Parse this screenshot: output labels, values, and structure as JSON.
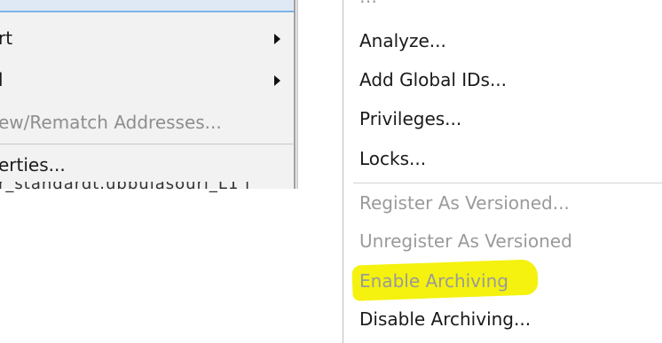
{
  "left_menu": {
    "items": [
      {
        "label": "rt",
        "submenu": true,
        "disabled": false
      },
      {
        "label": "l",
        "submenu": true,
        "disabled": false
      },
      {
        "label": "ew/Rematch Addresses...",
        "submenu": false,
        "disabled": true
      },
      {
        "label": "erties...",
        "submenu": false,
        "disabled": false
      }
    ]
  },
  "background_text": "r_standardt.ubbuiasouri_L1 i",
  "right_menu": {
    "items": [
      {
        "label": "Analyze...",
        "disabled": false
      },
      {
        "label": "Add Global IDs...",
        "disabled": false
      },
      {
        "label": "Privileges...",
        "disabled": false
      },
      {
        "label": "Locks...",
        "disabled": false
      },
      {
        "label": "Register As Versioned...",
        "disabled": true
      },
      {
        "label": "Unregister As Versioned",
        "disabled": true
      },
      {
        "label": "Enable Archiving",
        "disabled": true,
        "highlighted": true
      },
      {
        "label": "Disable Archiving...",
        "disabled": false
      }
    ]
  },
  "colors": {
    "highlight": "#f4f20e",
    "disabled_text": "#9a9a9a",
    "left_menu_bg": "#f2f2f2"
  }
}
